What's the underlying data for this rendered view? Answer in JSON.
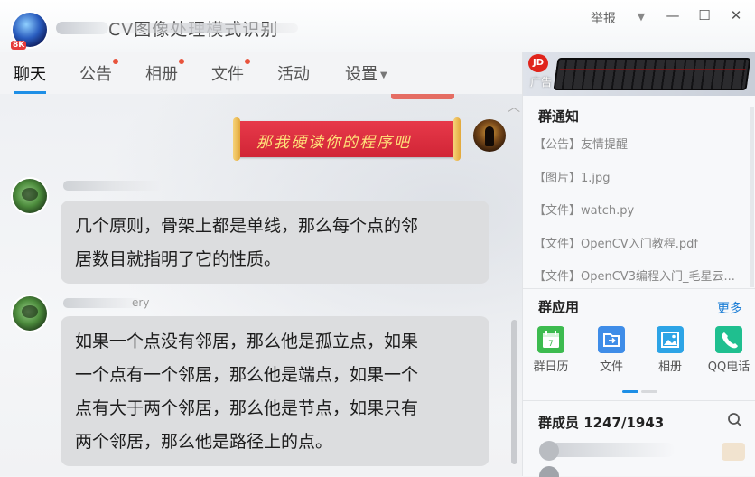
{
  "window": {
    "group_title": "CV图像处理模式识别",
    "group_badge": "8K",
    "report_label": "举报",
    "dropdown_glyph": "▼",
    "minimize_glyph": "—",
    "maximize_glyph": "☐",
    "close_glyph": "✕"
  },
  "tabs": [
    {
      "label": "聊天",
      "active": true,
      "dot": false
    },
    {
      "label": "公告",
      "active": false,
      "dot": true
    },
    {
      "label": "相册",
      "active": false,
      "dot": true
    },
    {
      "label": "文件",
      "active": false,
      "dot": true
    },
    {
      "label": "活动",
      "active": false,
      "dot": false
    },
    {
      "label": "设置",
      "active": false,
      "dot": false,
      "has_dropdown": true
    }
  ],
  "chat": {
    "my_message": "那我硬读你的程序吧",
    "messages": [
      {
        "lines": [
          "几个原则，骨架上都是单线，那么每个点的邻",
          "居数目就指明了它的性质。"
        ]
      },
      {
        "sender_suffix": "ery",
        "lines": [
          "如果一个点没有邻居，那么他是孤立点，如果",
          "一个点有一个邻居，那么他是端点，如果一个",
          "点有大于两个邻居，那么他是节点，如果只有",
          "两个邻居，那么他是路径上的点。"
        ]
      }
    ]
  },
  "ad": {
    "logo": "JD",
    "tag": "广告"
  },
  "notice": {
    "title": "群通知",
    "items": [
      "【公告】友情提醒",
      "【图片】1.jpg",
      "【文件】watch.py",
      "【文件】OpenCV入门教程.pdf",
      "【文件】OpenCV3编程入门_毛星云..."
    ]
  },
  "apps": {
    "title": "群应用",
    "more": "更多",
    "items": [
      {
        "label": "群日历",
        "icon": "calendar-icon",
        "color": "#3dbb4f"
      },
      {
        "label": "文件",
        "icon": "file-transfer-icon",
        "color": "#3f8de8"
      },
      {
        "label": "相册",
        "icon": "photo-icon",
        "color": "#2da4e6"
      },
      {
        "label": "QQ电话",
        "icon": "phone-icon",
        "color": "#1fbf8f"
      }
    ],
    "calendar_day": "7"
  },
  "members": {
    "title": "群成员 1247/1943"
  },
  "colors": {
    "accent": "#1e8fe6",
    "red_dot": "#e8533c",
    "bubble": "#dcdddf",
    "link": "#1e7fd6"
  }
}
